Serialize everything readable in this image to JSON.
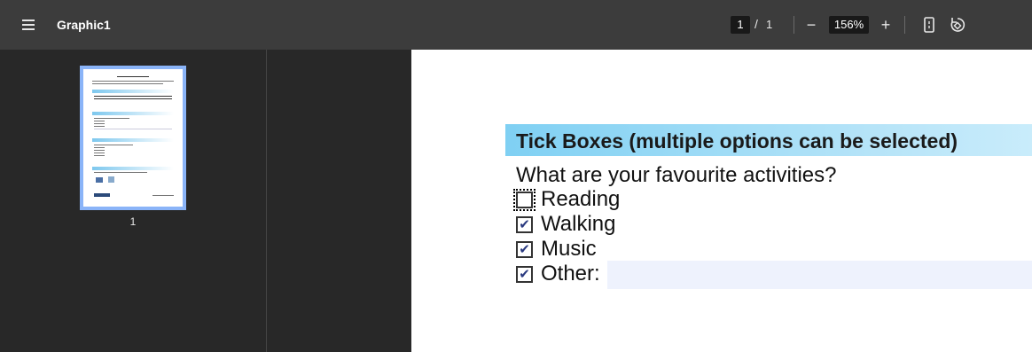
{
  "toolbar": {
    "title": "Graphic1",
    "current_page": "1",
    "page_separator": "/",
    "total_pages": "1",
    "zoom": "156%",
    "zoom_out_label": "−",
    "zoom_in_label": "+"
  },
  "sidebar": {
    "thumbnails": [
      {
        "label": "1"
      }
    ]
  },
  "document": {
    "section_title": "Tick Boxes (multiple options can be selected)",
    "question": "What are your favourite activities?",
    "options": [
      {
        "label": "Reading",
        "checked": false,
        "mark": ""
      },
      {
        "label": "Walking",
        "checked": true,
        "mark": "✔"
      },
      {
        "label": "Music",
        "checked": true,
        "mark": "✔"
      },
      {
        "label": "Other:",
        "checked": true,
        "mark": "✔"
      }
    ],
    "other_value": ""
  },
  "colors": {
    "toolbar_bg": "#3c3c3c",
    "viewer_bg": "#282828",
    "thumb_selected": "#8ab4f8",
    "header_gradient_start": "#7fd0f3",
    "field_bg": "#eef2fd"
  }
}
